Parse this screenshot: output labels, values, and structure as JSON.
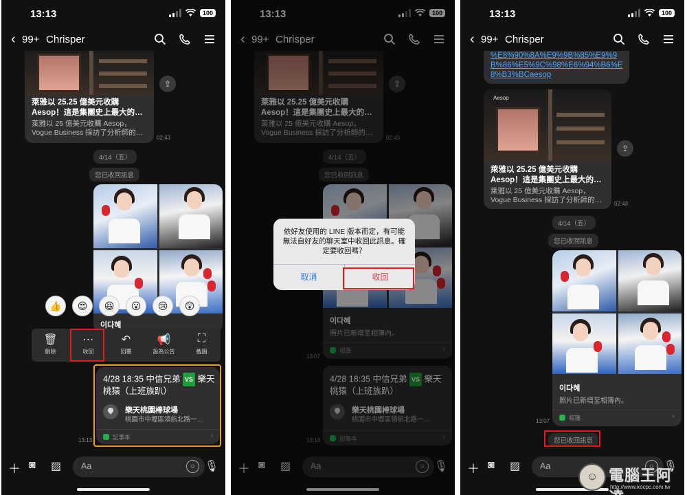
{
  "status_bar": {
    "time": "13:13",
    "battery": "100"
  },
  "header": {
    "back_count": "99+",
    "chat_name": "Chrisper"
  },
  "link_preview": {
    "logo": "Aesop",
    "title_line1": "萊雅以 25.25 億美元收購",
    "title_line2": "Aesop！這是集團史上最大的…",
    "desc_line1": "萊雅以 25 億美元收購 Aesop，",
    "desc_line2": "Vogue Business 採訪了分析師的…",
    "time": "02:43"
  },
  "url_tail": "%E8%90%8A%E9%9B%85%E9%9B%86%E5%9C%98%E6%94%B6%E8%B3%BCaesop",
  "date_separator": "4/14（五）",
  "recalled_notice": "您已收回訊息",
  "album": {
    "name": "이다혜",
    "subtitle": "照片已新增至相簿內。",
    "footer": "相簿",
    "time": "13:07"
  },
  "event": {
    "title_part1": "4/28 18:35 中信兄弟",
    "vs": "VS",
    "title_part2": "樂天",
    "title_line2": "桃猿（上班族趴）",
    "place": "樂天桃園棒球場",
    "address": "桃園市中壢區領航北路一…",
    "footer": "記事本",
    "time": "13:13"
  },
  "reactions": [
    "👍",
    "😍",
    "😆",
    "😮",
    "😢",
    "😲"
  ],
  "actions": [
    {
      "icon": "trash-icon",
      "glyph": "🗑",
      "label": "刪除"
    },
    {
      "icon": "recall-icon",
      "glyph": "⋯",
      "label": "收回"
    },
    {
      "icon": "reply-icon",
      "glyph": "↶",
      "label": "回覆"
    },
    {
      "icon": "announce-icon",
      "glyph": "📢",
      "label": "設為公告"
    },
    {
      "icon": "screenshot-icon",
      "glyph": "⛶",
      "label": "截圖"
    }
  ],
  "dialog": {
    "message": "依好友使用的 LINE 版本而定，有可能無法自好友的聊天室中收回此訊息。確定要收回嗎？",
    "cancel": "取消",
    "confirm": "收回"
  },
  "composer": {
    "placeholder": "Aa"
  },
  "watermark": {
    "text": "電腦王阿達",
    "url": "http://www.kocpc.com.tw"
  },
  "colors": {
    "highlight_red": "#e21b1b",
    "highlight_orange": "#e8a034",
    "link_blue": "#4ea3ff",
    "vs_green": "#1f9d3a"
  }
}
